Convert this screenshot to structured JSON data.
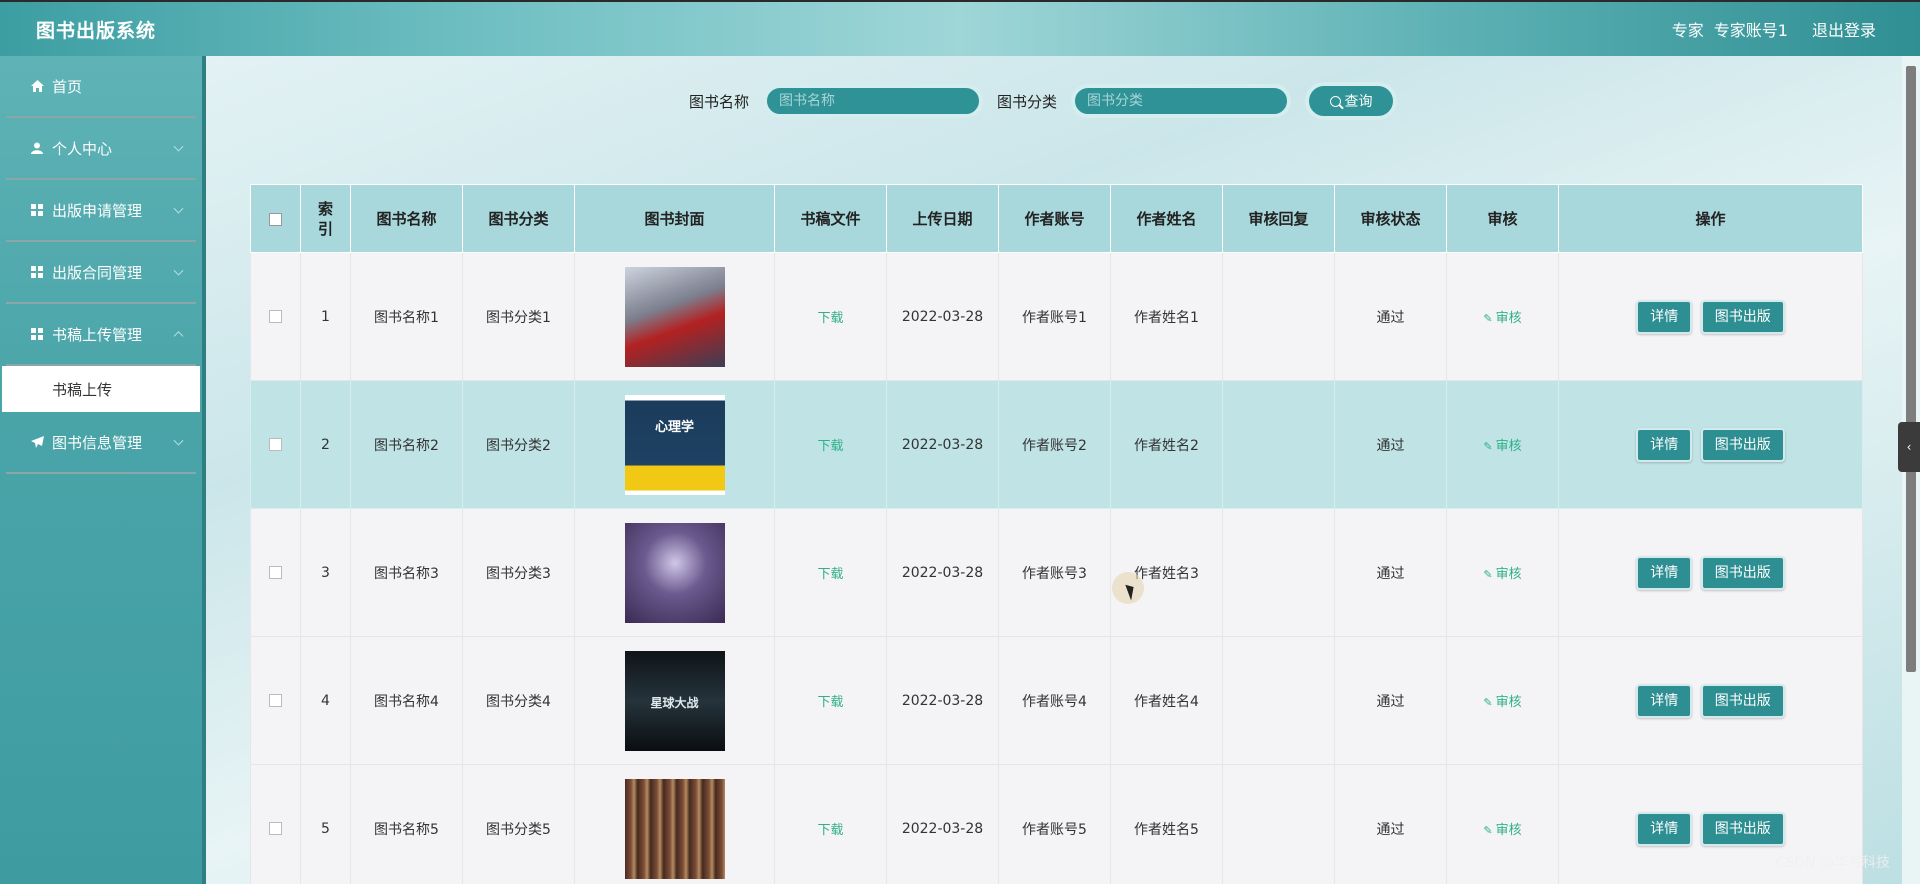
{
  "header": {
    "title": "图书出版系统",
    "role": "专家",
    "account": "专家账号1",
    "logout": "退出登录"
  },
  "sidebar": {
    "items": [
      {
        "label": "首页",
        "icon": "home-icon"
      },
      {
        "label": "个人中心",
        "icon": "user-icon"
      },
      {
        "label": "出版申请管理",
        "icon": "grid-icon"
      },
      {
        "label": "出版合同管理",
        "icon": "grid-icon"
      },
      {
        "label": "书稿上传管理",
        "icon": "grid-icon"
      },
      {
        "label": "书稿上传",
        "icon": ""
      },
      {
        "label": "图书信息管理",
        "icon": "send-icon"
      }
    ]
  },
  "search": {
    "name_label": "图书名称",
    "name_placeholder": "图书名称",
    "category_label": "图书分类",
    "category_placeholder": "图书分类",
    "button": "查询"
  },
  "table": {
    "headers": [
      "索引",
      "图书名称",
      "图书分类",
      "图书封面",
      "书稿文件",
      "上传日期",
      "作者账号",
      "作者姓名",
      "审核回复",
      "审核状态",
      "审核",
      "操作"
    ],
    "rows": [
      {
        "index": "1",
        "name": "图书名称1",
        "category": "图书分类1",
        "cover_text": "",
        "file": "下载",
        "date": "2022-03-28",
        "author_account": "作者账号1",
        "author_name": "作者姓名1",
        "reply": "",
        "status": "通过",
        "audit": "审核",
        "detail": "详情",
        "publish": "图书出版"
      },
      {
        "index": "2",
        "name": "图书名称2",
        "category": "图书分类2",
        "cover_text": "心理学",
        "file": "下载",
        "date": "2022-03-28",
        "author_account": "作者账号2",
        "author_name": "作者姓名2",
        "reply": "",
        "status": "通过",
        "audit": "审核",
        "detail": "详情",
        "publish": "图书出版"
      },
      {
        "index": "3",
        "name": "图书名称3",
        "category": "图书分类3",
        "cover_text": "",
        "file": "下载",
        "date": "2022-03-28",
        "author_account": "作者账号3",
        "author_name": "作者姓名3",
        "reply": "",
        "status": "通过",
        "audit": "审核",
        "detail": "详情",
        "publish": "图书出版"
      },
      {
        "index": "4",
        "name": "图书名称4",
        "category": "图书分类4",
        "cover_text": "星球大战",
        "file": "下载",
        "date": "2022-03-28",
        "author_account": "作者账号4",
        "author_name": "作者姓名4",
        "reply": "",
        "status": "通过",
        "audit": "审核",
        "detail": "详情",
        "publish": "图书出版"
      },
      {
        "index": "5",
        "name": "图书名称5",
        "category": "图书分类5",
        "cover_text": "",
        "file": "下载",
        "date": "2022-03-28",
        "author_account": "作者账号5",
        "author_name": "作者姓名5",
        "reply": "",
        "status": "通过",
        "audit": "审核",
        "detail": "详情",
        "publish": "图书出版"
      }
    ]
  },
  "colors": {
    "primary": "#2e9296",
    "header_bg": "#a8d8dc",
    "link_green": "#2fb089"
  },
  "watermark": "CSDN @华月科技"
}
